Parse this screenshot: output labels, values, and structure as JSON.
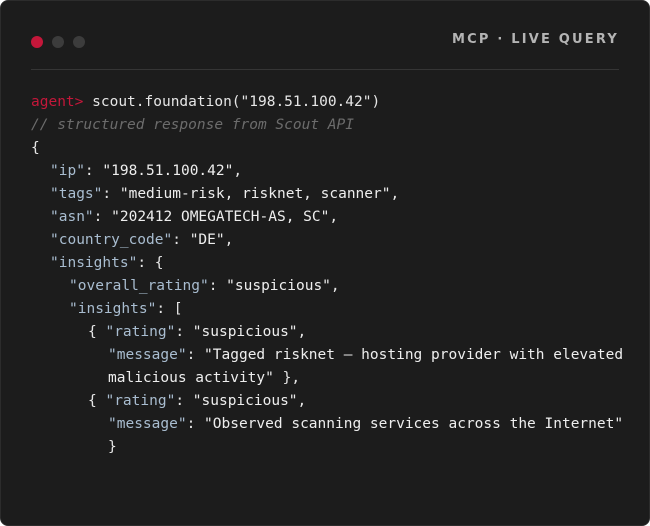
{
  "header": {
    "title": "MCP · LIVE QUERY"
  },
  "terminal": {
    "prompt": "agent>",
    "command": "scout.foundation(\"198.51.100.42\")",
    "comment": "// structured response from Scout API",
    "response": {
      "ip_key": "\"ip\"",
      "ip_value": "\"198.51.100.42\"",
      "tags_key": "\"tags\"",
      "tags_value": "\"medium-risk, risknet, scanner\"",
      "asn_key": "\"asn\"",
      "asn_value": "\"202412 OMEGATECH-AS, SC\"",
      "country_key": "\"country_code\"",
      "country_value": "\"DE\"",
      "insights_key": "\"insights\"",
      "overall_rating_key": "\"overall_rating\"",
      "overall_rating_value": "\"suspicious\"",
      "insights_list_key": "\"insights\"",
      "items": [
        {
          "rating_key": "\"rating\"",
          "rating_value": "\"suspicious\"",
          "message_key": "\"message\"",
          "message_value_line1": "\"Tagged risknet — hosting provider with elevated",
          "message_value_line2": "malicious activity\""
        },
        {
          "rating_key": "\"rating\"",
          "rating_value": "\"suspicious\"",
          "message_key": "\"message\"",
          "message_value": "\"Observed scanning services across the Internet\""
        }
      ]
    }
  }
}
